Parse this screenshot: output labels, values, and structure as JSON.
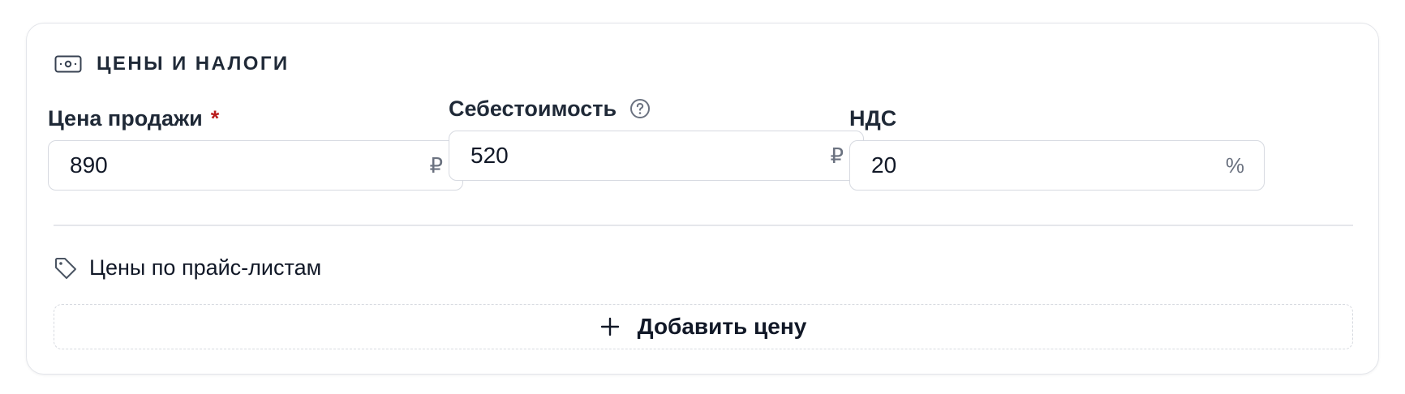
{
  "section": {
    "title": "ЦЕНЫ И НАЛОГИ",
    "icon": "banknote-icon"
  },
  "fields": {
    "sale_price": {
      "label": "Цена продажи",
      "required_mark": "*",
      "value": "890",
      "suffix": "₽"
    },
    "cost_price": {
      "label": "Себестоимость",
      "help_icon": "question-circle-icon",
      "value": "520",
      "suffix": "₽"
    },
    "vat": {
      "label": "НДС",
      "value": "20",
      "suffix": "%"
    }
  },
  "price_lists": {
    "title": "Цены по прайс-листам",
    "icon": "tag-icon",
    "add_button_label": "Добавить цену",
    "add_icon": "plus-icon"
  },
  "colors": {
    "required": "#b91c1c",
    "border": "#d6d9e0",
    "muted": "#6b7280"
  }
}
